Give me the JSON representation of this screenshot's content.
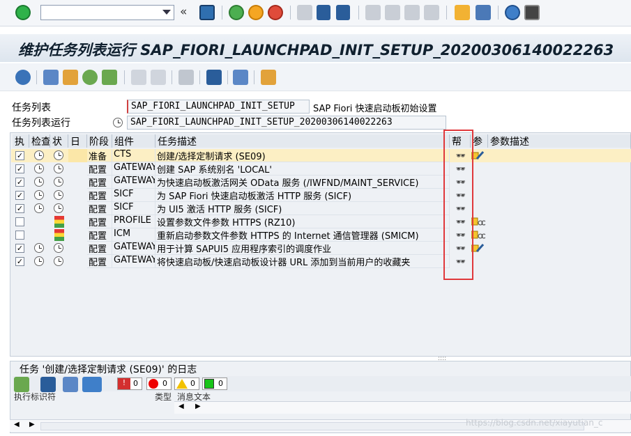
{
  "page": {
    "title": "维护任务列表运行 SAP_FIORI_LAUNCHPAD_INIT_SETUP_20200306140022263"
  },
  "header": {
    "task_list_label": "任务列表",
    "task_list_value": "SAP_FIORI_LAUNCHPAD_INIT_SETUP",
    "task_list_desc": "SAP Fiori 快速启动板初始设置",
    "run_label": "任务列表运行",
    "run_value": "SAP_FIORI_LAUNCHPAD_INIT_SETUP_20200306140022263"
  },
  "table": {
    "columns": [
      "执",
      "检查",
      "状",
      "日",
      "阶段",
      "组件",
      "任务描述",
      "帮",
      "参",
      "参数描述"
    ],
    "rows": [
      {
        "exec": true,
        "check": true,
        "status": "clock",
        "phase": "准备",
        "component": "CTS",
        "desc": "创建/选择定制请求 (SE09)",
        "param": "pencil",
        "selected": true
      },
      {
        "exec": true,
        "check": true,
        "status": "clock",
        "phase": "配置",
        "component": "GATEWAY",
        "desc": "创建 SAP 系统别名 'LOCAL'",
        "param": ""
      },
      {
        "exec": true,
        "check": true,
        "status": "clock",
        "phase": "配置",
        "component": "GATEWAY",
        "desc": "为快速启动板激活网关 OData 服务 (/IWFND/MAINT_SERVICE)",
        "param": ""
      },
      {
        "exec": true,
        "check": true,
        "status": "clock",
        "phase": "配置",
        "component": "SICF",
        "desc": "为 SAP Fiori 快速启动板激活 HTTP 服务 (SICF)",
        "param": ""
      },
      {
        "exec": true,
        "check": true,
        "status": "clock",
        "phase": "配置",
        "component": "SICF",
        "desc": "为 UI5 激活 HTTP 服务 (SICF)",
        "param": ""
      },
      {
        "exec": false,
        "check": false,
        "status": "manual",
        "phase": "配置",
        "component": "PROFILE",
        "desc": "设置参数文件参数 HTTPS (RZ10)",
        "param": "doc"
      },
      {
        "exec": false,
        "check": false,
        "status": "manual",
        "phase": "配置",
        "component": "ICM",
        "desc": "重新启动参数文件参数 HTTPS 的 Internet 通信管理器 (SMICM)",
        "param": "doc"
      },
      {
        "exec": true,
        "check": true,
        "status": "clock",
        "phase": "配置",
        "component": "GATEWAY",
        "desc": "用于计算 SAPUI5 应用程序索引的调度作业",
        "param": "pencil"
      },
      {
        "exec": true,
        "check": true,
        "status": "clock",
        "phase": "配置",
        "component": "GATEWAY",
        "desc": "将快速启动板/快速启动板设计器 URL 添加到当前用户的收藏夹",
        "param": ""
      }
    ]
  },
  "log": {
    "title": "任务 '创建/选择定制请求 (SE09)' 的日志",
    "counts": {
      "error": "0",
      "stop": "0",
      "warning": "0",
      "ok": "0"
    },
    "col_exec_id": "执行标识符",
    "col_type": "类型",
    "col_msg": "消息文本"
  },
  "watermark": "https://blog.csdn.net/xiayutian_c",
  "colors": {
    "selected_row": "#fcefc4",
    "highlight_box": "#e0383b",
    "title": "#10202f"
  }
}
